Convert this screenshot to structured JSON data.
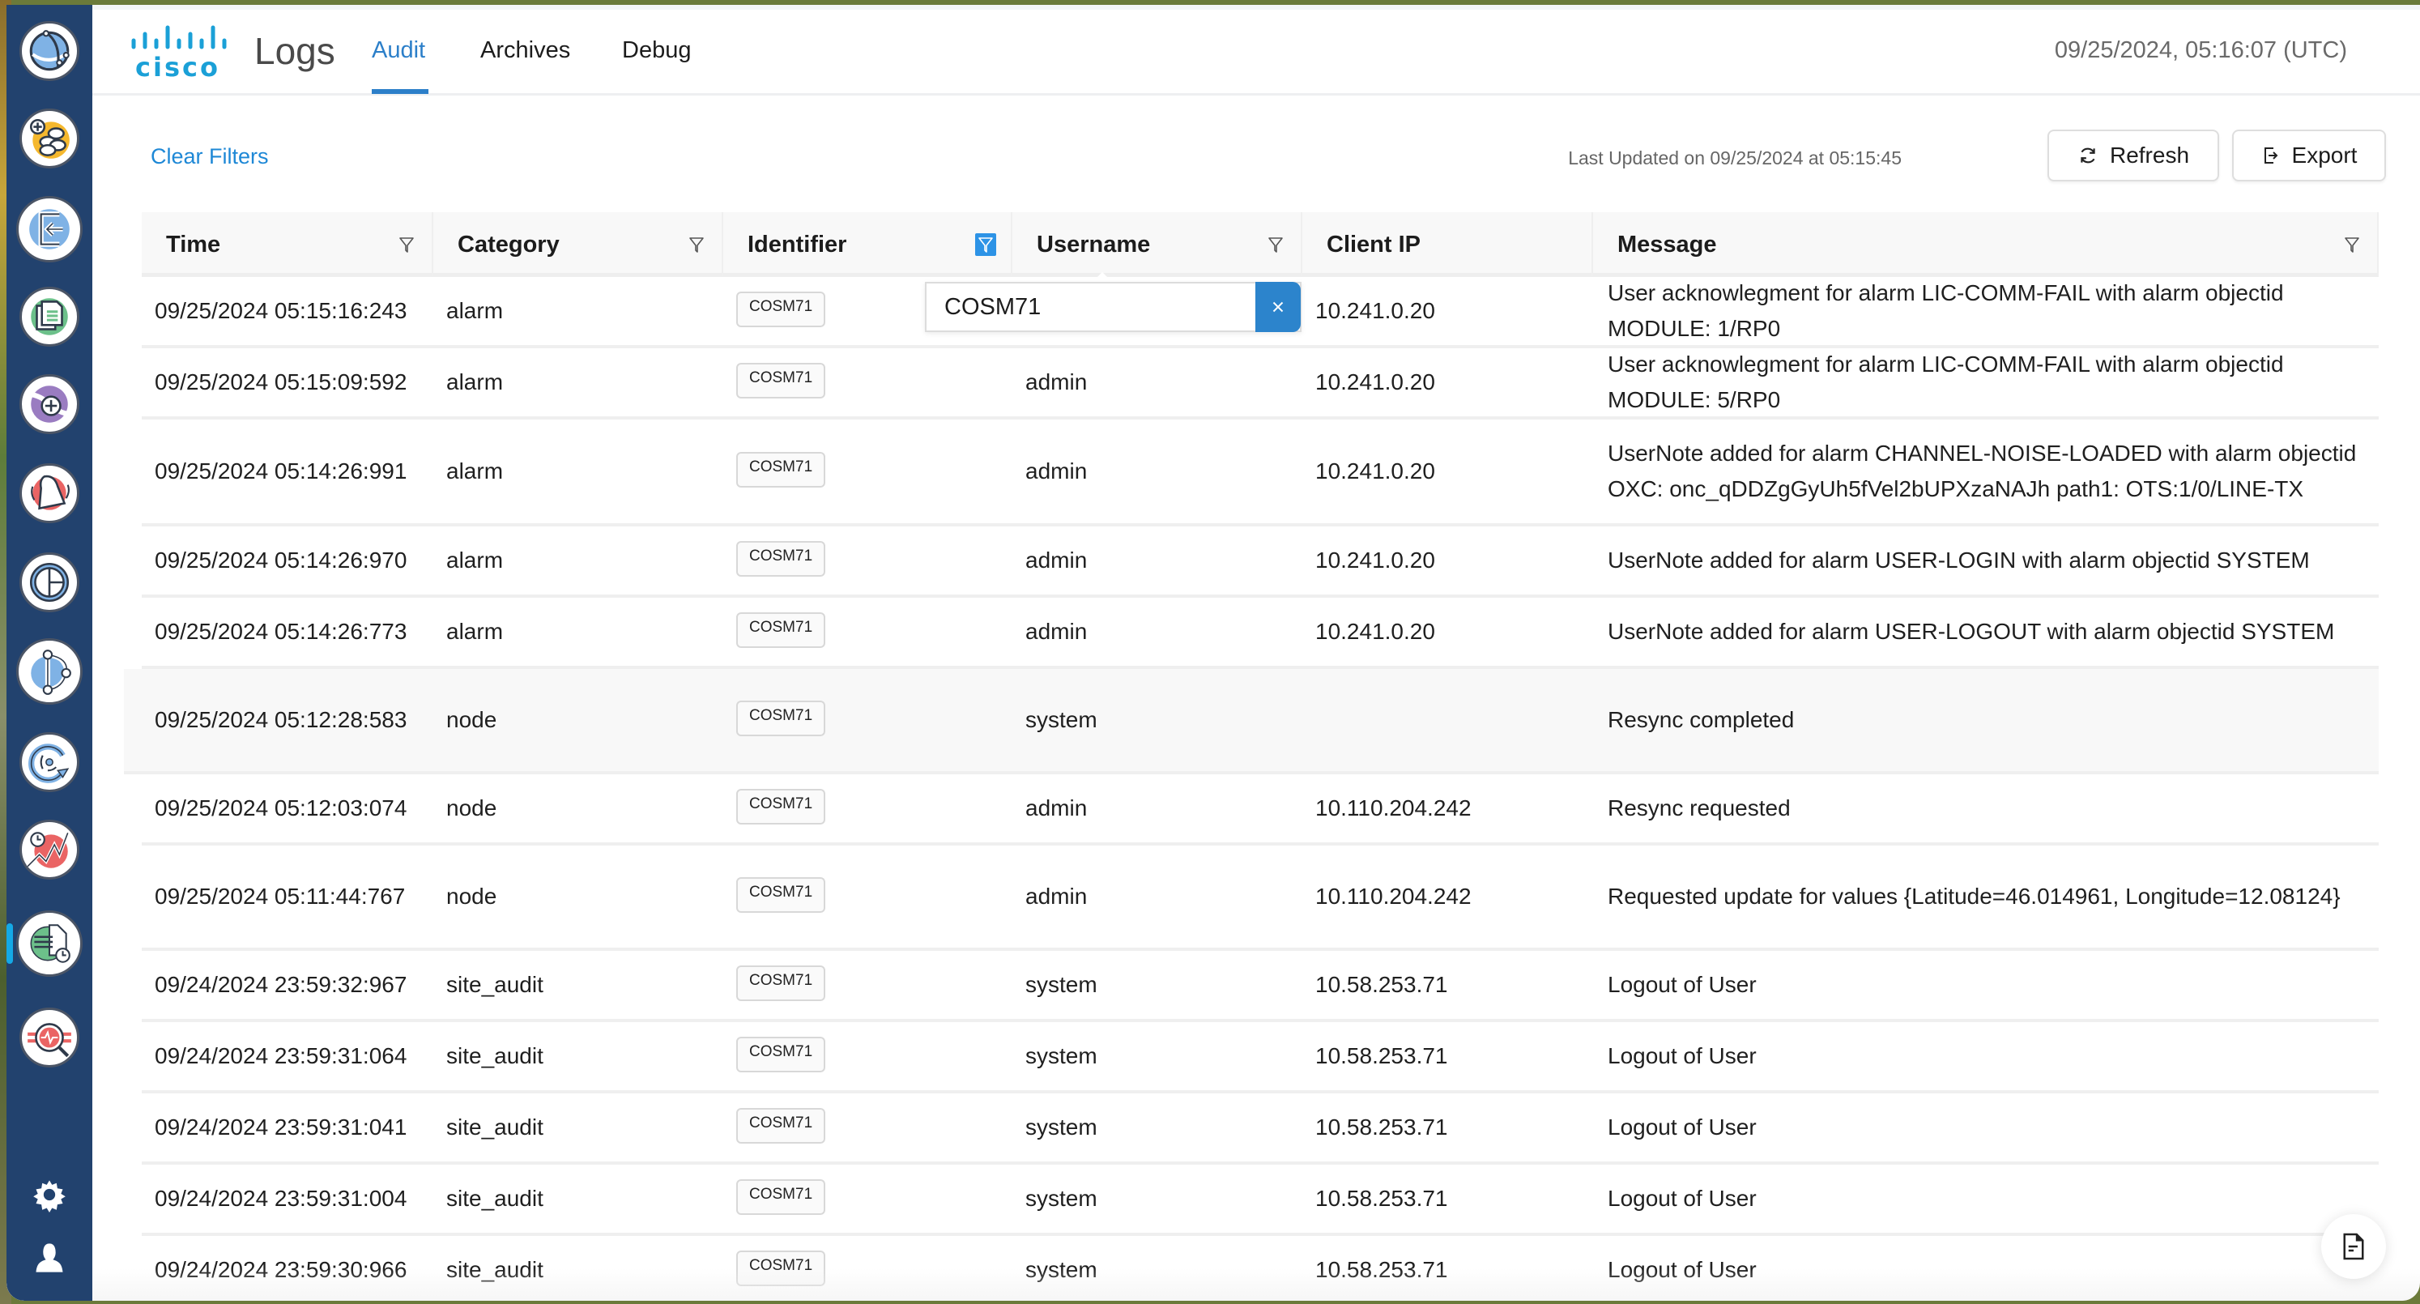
{
  "app": {
    "brand": "cisco",
    "title": "Logs",
    "clock": "09/25/2024, 05:16:07 (UTC)"
  },
  "tabs": [
    {
      "label": "Audit",
      "active": true
    },
    {
      "label": "Archives",
      "active": false
    },
    {
      "label": "Debug",
      "active": false
    }
  ],
  "sidebar": {
    "items": [
      {
        "icon": "network-globe-icon"
      },
      {
        "icon": "add-devices-icon"
      },
      {
        "icon": "import-icon"
      },
      {
        "icon": "documents-icon"
      },
      {
        "icon": "add-link-icon"
      },
      {
        "icon": "alarm-bell-icon"
      },
      {
        "icon": "pie-chart-icon"
      },
      {
        "icon": "topology-icon"
      },
      {
        "icon": "sync-disc-icon"
      },
      {
        "icon": "performance-history-icon"
      },
      {
        "icon": "logs-icon",
        "active": true
      },
      {
        "icon": "diagnostics-search-icon"
      }
    ],
    "bottom": [
      {
        "icon": "gear-icon"
      },
      {
        "icon": "user-icon"
      }
    ]
  },
  "toolbar": {
    "clear_filters": "Clear Filters",
    "last_updated": "Last Updated on 09/25/2024 at 05:15:45",
    "refresh_label": "Refresh",
    "export_label": "Export"
  },
  "table": {
    "columns": [
      {
        "label": "Time",
        "filter": true,
        "filter_active": false
      },
      {
        "label": "Category",
        "filter": true,
        "filter_active": false
      },
      {
        "label": "Identifier",
        "filter": true,
        "filter_active": true
      },
      {
        "label": "Username",
        "filter": true,
        "filter_active": false
      },
      {
        "label": "Client IP",
        "filter": false,
        "filter_active": false
      },
      {
        "label": "Message",
        "filter": true,
        "filter_active": false
      }
    ],
    "rows": [
      {
        "time": "09/25/2024 05:15:16:243",
        "category": "alarm",
        "identifier": "COSM71",
        "username": "",
        "client_ip": "10.241.0.20",
        "message": "User acknowlegment for alarm LIC-COMM-FAIL with alarm objectid MODULE: 1/RP0"
      },
      {
        "time": "09/25/2024 05:15:09:592",
        "category": "alarm",
        "identifier": "COSM71",
        "username": "admin",
        "client_ip": "10.241.0.20",
        "message": "User acknowlegment for alarm LIC-COMM-FAIL with alarm objectid MODULE: 5/RP0"
      },
      {
        "time": "09/25/2024 05:14:26:991",
        "category": "alarm",
        "identifier": "COSM71",
        "username": "admin",
        "client_ip": "10.241.0.20",
        "message": "UserNote added for alarm CHANNEL-NOISE-LOADED with alarm objectid OXC: onc_qDDZgGyUh5fVel2bUPXzaNAJh path1: OTS:1/0/LINE-TX"
      },
      {
        "time": "09/25/2024 05:14:26:970",
        "category": "alarm",
        "identifier": "COSM71",
        "username": "admin",
        "client_ip": "10.241.0.20",
        "message": "UserNote added for alarm USER-LOGIN with alarm objectid SYSTEM"
      },
      {
        "time": "09/25/2024 05:14:26:773",
        "category": "alarm",
        "identifier": "COSM71",
        "username": "admin",
        "client_ip": "10.241.0.20",
        "message": "UserNote added for alarm USER-LOGOUT with alarm objectid SYSTEM"
      },
      {
        "time": "09/25/2024 05:12:28:583",
        "category": "node",
        "identifier": "COSM71",
        "username": "system",
        "client_ip": "",
        "message": "Resync completed"
      },
      {
        "time": "09/25/2024 05:12:03:074",
        "category": "node",
        "identifier": "COSM71",
        "username": "admin",
        "client_ip": "10.110.204.242",
        "message": "Resync requested"
      },
      {
        "time": "09/25/2024 05:11:44:767",
        "category": "node",
        "identifier": "COSM71",
        "username": "admin",
        "client_ip": "10.110.204.242",
        "message": "Requested update for values {Latitude=46.014961, Longitude=12.08124}"
      },
      {
        "time": "09/24/2024 23:59:32:967",
        "category": "site_audit",
        "identifier": "COSM71",
        "username": "system",
        "client_ip": "10.58.253.71",
        "message": "Logout of User"
      },
      {
        "time": "09/24/2024 23:59:31:064",
        "category": "site_audit",
        "identifier": "COSM71",
        "username": "system",
        "client_ip": "10.58.253.71",
        "message": "Logout of User"
      },
      {
        "time": "09/24/2024 23:59:31:041",
        "category": "site_audit",
        "identifier": "COSM71",
        "username": "system",
        "client_ip": "10.58.253.71",
        "message": "Logout of User"
      },
      {
        "time": "09/24/2024 23:59:31:004",
        "category": "site_audit",
        "identifier": "COSM71",
        "username": "system",
        "client_ip": "10.58.253.71",
        "message": "Logout of User"
      },
      {
        "time": "09/24/2024 23:59:30:966",
        "category": "site_audit",
        "identifier": "COSM71",
        "username": "system",
        "client_ip": "10.58.253.71",
        "message": "Logout of User"
      }
    ]
  },
  "identifier_filter": {
    "value": "COSM71"
  },
  "colors": {
    "accent": "#2c7fc9",
    "link": "#1e88d6",
    "sidebar": "#22426e",
    "active_indicator": "#14a9e6"
  }
}
